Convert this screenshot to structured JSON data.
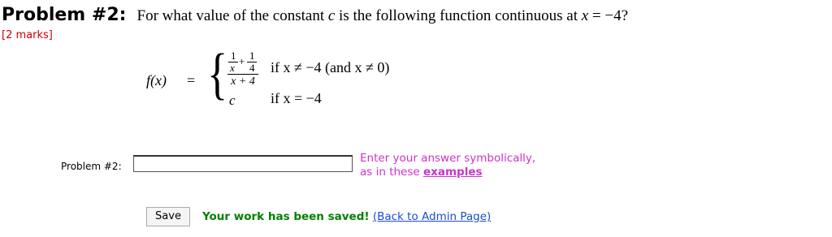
{
  "problem": {
    "title": "Problem #2:",
    "question_pre": "For what value of the constant",
    "question_var": "c",
    "question_mid": "is the following function continuous at",
    "question_x": "x",
    "question_post": "= −4?",
    "marks": "[2 marks]"
  },
  "function": {
    "fx": "f(x)",
    "equals": "=",
    "brace": "{",
    "frac": {
      "num1": "1",
      "den1": "x",
      "plus": "+",
      "num2": "1",
      "den2": "4",
      "denominator": "x + 4"
    },
    "case1_cond": "if x ≠ −4  (and x ≠ 0)",
    "case2_value": "c",
    "case2_cond": "if x = −4"
  },
  "answer": {
    "label": "Problem #2:",
    "value": "",
    "hint_line1": "Enter your answer symbolically,",
    "hint_line2_pre": "as in these",
    "hint_link": "examples"
  },
  "footer": {
    "save_label": "Save",
    "saved_message": "Your work has been saved!",
    "admin_link": "(Back to Admin Page)"
  }
}
